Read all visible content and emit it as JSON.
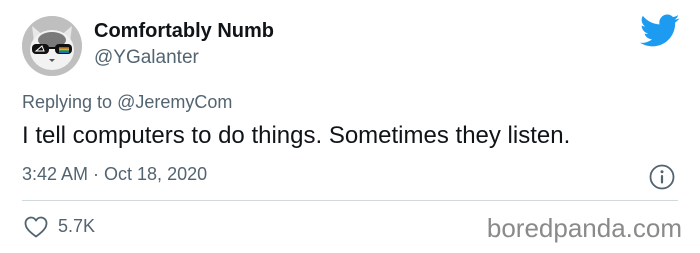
{
  "author": {
    "display_name": "Comfortably Numb",
    "handle": "@YGalanter"
  },
  "reply_context": {
    "prefix": "Replying to",
    "mention": "@JeremyCom"
  },
  "tweet": {
    "text": "I tell computers to do things. Sometimes they listen.",
    "timestamp": "3:42 AM · Oct 18, 2020",
    "like_count": "5.7K"
  },
  "watermark": "boredpanda.com",
  "colors": {
    "twitter_blue": "#1d9bf0",
    "secondary_text": "#536471",
    "divider": "#cfd9de"
  },
  "icons": {
    "logo": "twitter-bird-icon",
    "info": "info-icon",
    "like": "heart-icon",
    "avatar": "cat-with-glasses-avatar"
  }
}
